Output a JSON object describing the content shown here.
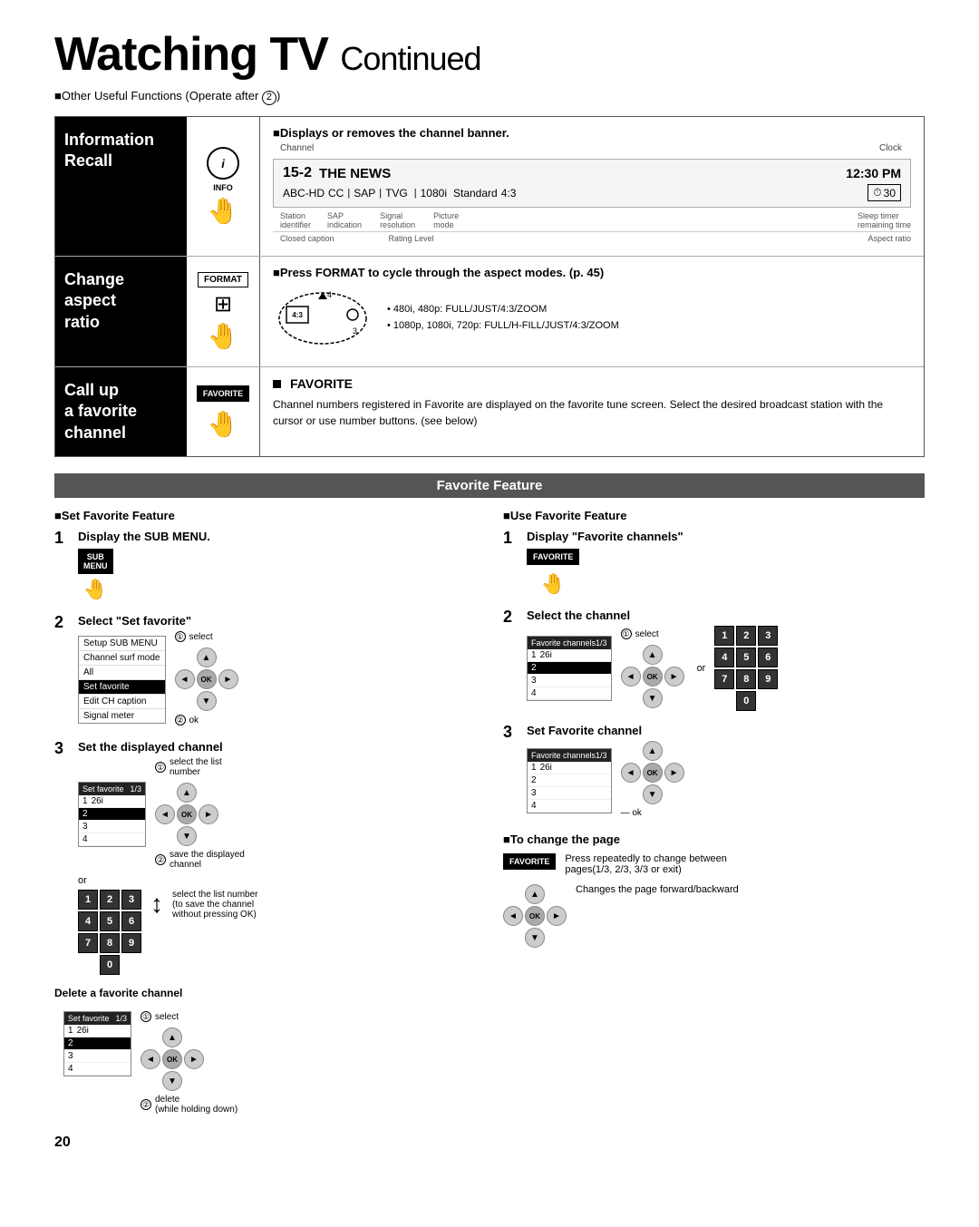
{
  "page": {
    "title": "Watching TV",
    "title_continued": "Continued",
    "page_number": "20",
    "subtitle": "■Other Useful Functions (Operate after",
    "circle_num": "2"
  },
  "info_row": {
    "label": "Information\nRecall",
    "section_title": "■Displays or removes the channel banner.",
    "button_label": "INFO",
    "banner": {
      "channel_label": "Channel",
      "clock_label": "Clock",
      "channel_num": "15-2",
      "network": "ABC-HD",
      "cc": "CC",
      "sap": "SAP",
      "tvg": "TVG",
      "resolution": "1080i",
      "picture": "Standard",
      "aspect": "4:3",
      "time": "12:30 PM",
      "sleep_icon": "⏱",
      "sleep_val": "30",
      "station_label": "Station\nidentifier",
      "sap_label": "SAP\nindication",
      "signal_label": "Signal\nresolution",
      "picture_label": "Picture\nmode",
      "sleep_label": "Sleep timer\nremaining time",
      "cc_note": "Closed caption",
      "rating_note": "Rating Level",
      "aspect_note": "Aspect ratio",
      "channel_name": "THE NEWS"
    }
  },
  "aspect_row": {
    "label": "Change\naspect\nratio",
    "section_title": "■Press FORMAT to cycle through the aspect modes. (p. 45)",
    "format_label": "FORMAT",
    "note1": "• 480i, 480p:  FULL/JUST/4:3/ZOOM",
    "note2": "• 1080p, 1080i, 720p: FULL/H-FILL/JUST/4:3/ZOOM",
    "diagram_4": "4",
    "diagram_4_3": "4:3",
    "diagram_3": "3"
  },
  "favorite_row": {
    "label": "Call up\na favorite\nchannel",
    "button_label": "FAVORITE",
    "section_title": "■FAVORITE",
    "description": "Channel numbers registered in Favorite are displayed on the favorite tune screen. Select the desired broadcast station with the cursor or use number buttons. (see below)"
  },
  "favorite_feature": {
    "header": "Favorite Feature",
    "set_heading": "■Set Favorite Feature",
    "use_heading": "■Use Favorite Feature",
    "step1_set_label": "Display the SUB MENU.",
    "step1_use_label": "Display \"Favorite channels\"",
    "step2_set_label": "Select \"Set favorite\"",
    "step2_use_label": "Select the channel",
    "step3_set_label": "Set the displayed channel",
    "step3_use_label": "Set Favorite channel",
    "delete_label": "Delete a favorite channel",
    "to_change_page": "■To change the page",
    "sub_menu_label": "SUB\nMENU",
    "fav_label": "FAVORITE",
    "select_annot1": "①select",
    "ok_annot1": "②ok",
    "select_list_annot": "①select the list\nnumber",
    "save_annot": "②save the displayed\nchannel",
    "select_list_num": "select the list number\n(to save the channel\nwithout pressing OK)",
    "ok_annot2": "ok",
    "select_annot2": "①select",
    "delete_annot": "②delete\n(while holding down)",
    "to_change_desc": "Press repeatedly to change between\npages(1/3, 2/3, 3/3 or exit)",
    "change_page_desc": "Changes the page forward/backward",
    "or_text": "or",
    "sub_menu_items": [
      {
        "label": "Setup SUB MENU",
        "selected": false
      },
      {
        "label": "Channel surf mode",
        "selected": false
      },
      {
        "label": "All",
        "selected": false
      },
      {
        "label": "Set favorite",
        "selected": true
      },
      {
        "label": "Edit CH caption",
        "selected": false
      },
      {
        "label": "Signal meter",
        "selected": false
      }
    ],
    "fav_list_1_3": {
      "header_left": "Favorite channels",
      "header_right": "1/3",
      "items": [
        {
          "num": "1",
          "ch": "26i",
          "selected": false
        },
        {
          "num": "2",
          "ch": "",
          "selected": true
        },
        {
          "num": "3",
          "ch": "",
          "selected": false
        },
        {
          "num": "4",
          "ch": "",
          "selected": false
        }
      ]
    },
    "set_fav_list": {
      "header_left": "Set favorite",
      "header_right": "1/3",
      "items": [
        {
          "num": "1",
          "ch": "26i",
          "selected": false
        },
        {
          "num": "2",
          "ch": "",
          "selected": true
        },
        {
          "num": "3",
          "ch": "",
          "selected": false
        },
        {
          "num": "4",
          "ch": "",
          "selected": false
        }
      ]
    },
    "set_fav_list2": {
      "header_left": "Favorite channels",
      "header_right": "1/3",
      "items": [
        {
          "num": "1",
          "ch": "26i",
          "selected": false
        },
        {
          "num": "2",
          "ch": "",
          "selected": false
        },
        {
          "num": "3",
          "ch": "",
          "selected": false
        },
        {
          "num": "4",
          "ch": "",
          "selected": false
        }
      ]
    },
    "del_list": {
      "header_left": "Set favorite",
      "header_right": "1/3",
      "items": [
        {
          "num": "1",
          "ch": "26i",
          "selected": false
        },
        {
          "num": "2",
          "ch": "",
          "selected": true
        },
        {
          "num": "3",
          "ch": "",
          "selected": false
        },
        {
          "num": "4",
          "ch": "",
          "selected": false
        }
      ]
    },
    "num_buttons": [
      "1",
      "2",
      "3",
      "4",
      "5",
      "6",
      "7",
      "8",
      "9",
      "0"
    ]
  }
}
